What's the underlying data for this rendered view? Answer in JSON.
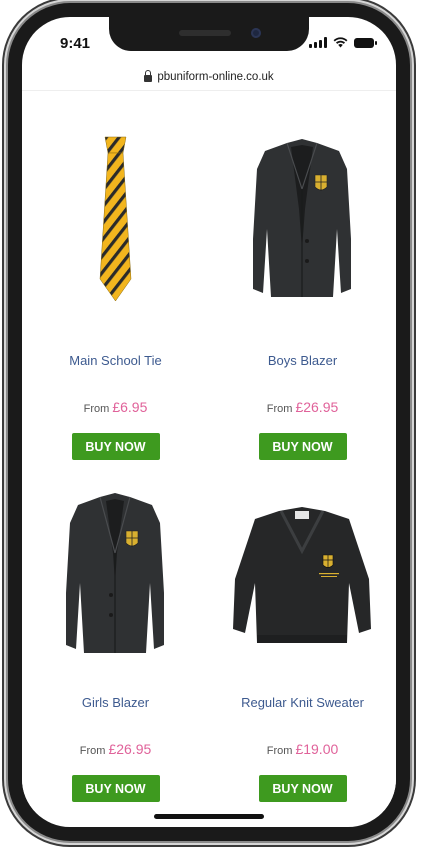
{
  "status_bar": {
    "time": "9:41"
  },
  "browser": {
    "url": "pbuniform-online.co.uk"
  },
  "products": [
    {
      "name": "Main School Tie",
      "price_prefix": "From",
      "price": "£6.95",
      "button": "BUY NOW",
      "icon": "striped-tie-image"
    },
    {
      "name": "Boys Blazer",
      "price_prefix": "From",
      "price": "£26.95",
      "button": "BUY NOW",
      "icon": "blazer-image"
    },
    {
      "name": "Girls Blazer",
      "price_prefix": "From",
      "price": "£26.95",
      "button": "BUY NOW",
      "icon": "blazer-image"
    },
    {
      "name": "Regular Knit Sweater",
      "price_prefix": "From",
      "price": "£19.00",
      "button": "BUY NOW",
      "icon": "sweater-image"
    }
  ],
  "colors": {
    "product_name": "#3d5a8f",
    "price": "#e0629a",
    "buy_button": "#3e9a1f",
    "tie_yellow": "#f2b51e",
    "tie_stripe": "#2a2a2a",
    "garment": "#2f3133",
    "crest": "#d9b030"
  }
}
